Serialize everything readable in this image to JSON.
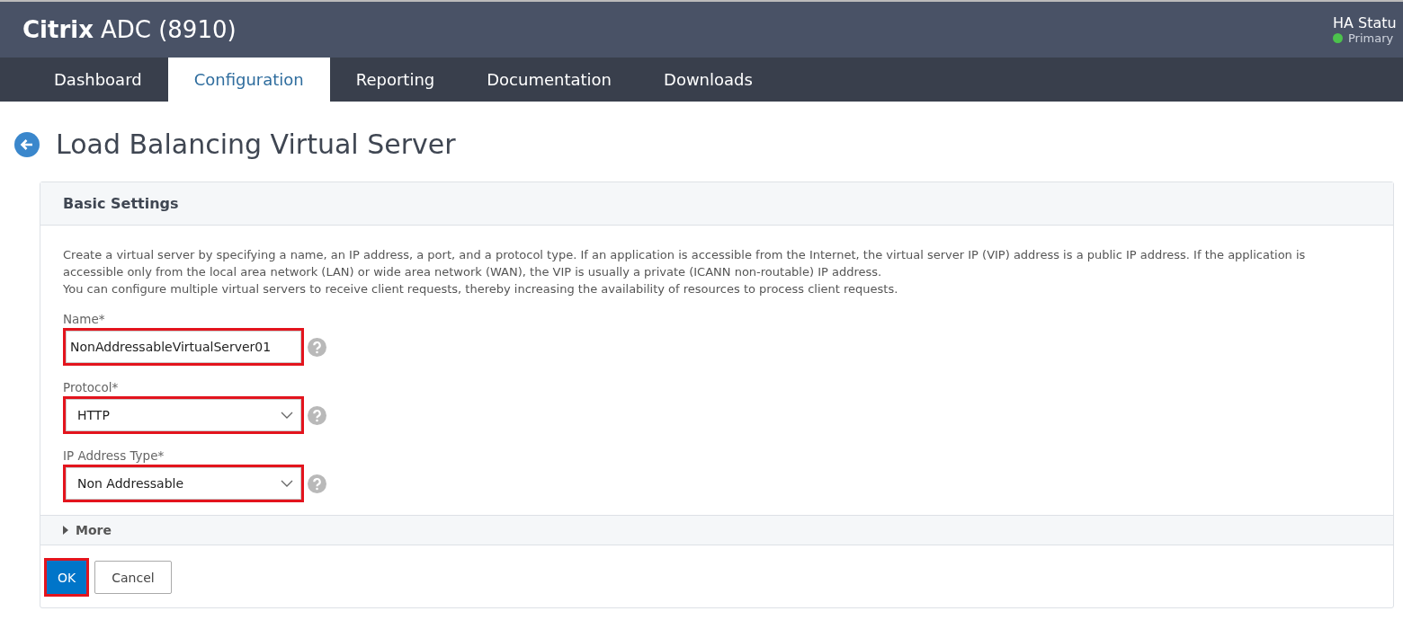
{
  "header": {
    "brand": "Citrix",
    "product": "ADC (8910)",
    "ha_status": {
      "label": "HA Statu",
      "state": "Primary",
      "color": "#4cc24c"
    }
  },
  "tabs": [
    {
      "label": "Dashboard",
      "selected": false
    },
    {
      "label": "Configuration",
      "selected": true
    },
    {
      "label": "Reporting",
      "selected": false
    },
    {
      "label": "Documentation",
      "selected": false
    },
    {
      "label": "Downloads",
      "selected": false
    }
  ],
  "page_title": "Load Balancing Virtual Server",
  "panel": {
    "title": "Basic Settings",
    "description": [
      "Create a virtual server by specifying a name, an IP address, a port, and a protocol type. If an application is accessible from the Internet, the virtual server IP (VIP) address is a public IP address. If the application is accessible only from the local area network (LAN) or wide area network (WAN), the VIP is usually a private (ICANN non-routable) IP address.",
      "You can configure multiple virtual servers to receive client requests, thereby increasing the availability of resources to process client requests."
    ],
    "fields": [
      {
        "kind": "text",
        "label": "Name*",
        "value": "NonAddressableVirtualServer01",
        "highlighted": true
      },
      {
        "kind": "select",
        "label": "Protocol*",
        "value": "HTTP",
        "highlighted": true
      },
      {
        "kind": "select",
        "label": "IP Address Type*",
        "value": "Non Addressable",
        "highlighted": true
      }
    ],
    "more": {
      "label": "More",
      "expanded": false
    },
    "buttons": [
      {
        "kind": "primary",
        "label": "OK",
        "highlighted": true
      },
      {
        "kind": "secondary",
        "label": "Cancel",
        "highlighted": false
      }
    ]
  }
}
